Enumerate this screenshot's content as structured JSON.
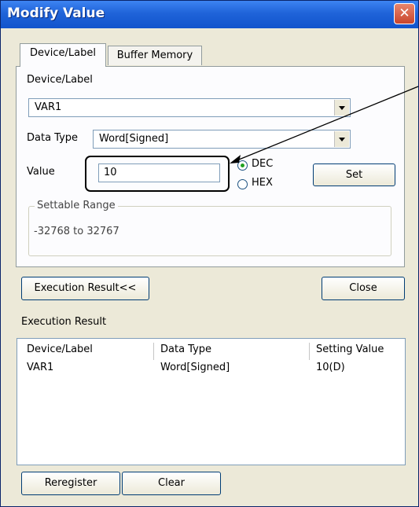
{
  "window": {
    "title": "Modify Value",
    "close_glyph": "✕"
  },
  "tabs": [
    {
      "label": "Device/Label",
      "active": true
    },
    {
      "label": "Buffer Memory",
      "active": false
    }
  ],
  "device": {
    "label": "Device/Label",
    "value": "VAR1"
  },
  "datatype": {
    "label": "Data Type",
    "value": "Word[Signed]"
  },
  "value": {
    "label": "Value",
    "input": "10"
  },
  "radix": {
    "dec_label": "DEC",
    "hex_label": "HEX",
    "selected": "DEC"
  },
  "set_button": "Set",
  "range": {
    "title": "Settable Range",
    "text": "-32768 to 32767"
  },
  "execution_result_button": "Execution Result<<",
  "close_button": "Close",
  "result": {
    "title": "Execution Result",
    "columns": [
      "Device/Label",
      "Data Type",
      "Setting Value"
    ],
    "rows": [
      [
        "VAR1",
        "Word[Signed]",
        "10(D)"
      ]
    ]
  },
  "reregister_button": "Reregister",
  "clear_button": "Clear",
  "colors": {
    "titlebar": "#1f63d9",
    "window_bg": "#ece9d8",
    "panel_bg": "#fcfcfe"
  }
}
